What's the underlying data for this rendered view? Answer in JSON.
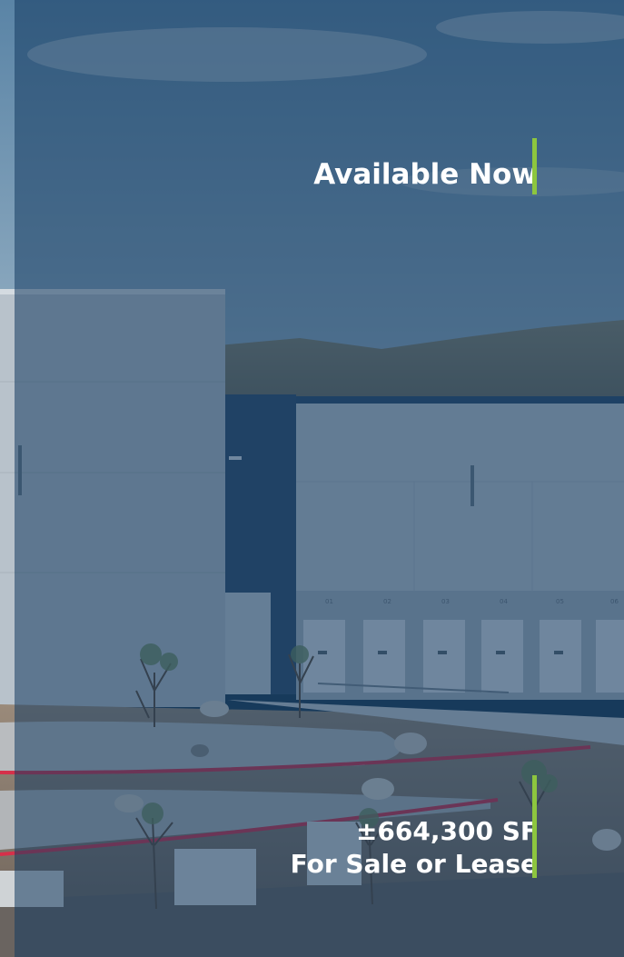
{
  "headline": "Available Now",
  "size_line": "±664,300 SF",
  "offer_line": "For Sale or Lease",
  "dock_numbers": [
    "01",
    "02",
    "03",
    "04",
    "05",
    "06"
  ],
  "colors": {
    "accent": "#8dc63f",
    "overlay": "#143a60",
    "text": "#ffffff",
    "curb": "#d6304a"
  },
  "image_subject": "industrial-warehouse-building-photo"
}
